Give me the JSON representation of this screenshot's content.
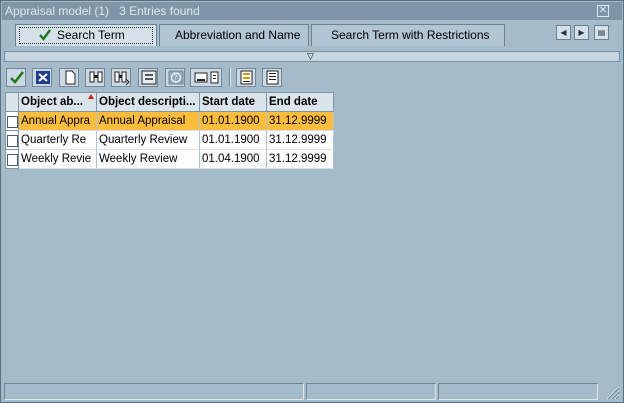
{
  "window": {
    "title": "Appraisal model (1)",
    "entries": "3 Entries found",
    "close_glyph": "✕"
  },
  "tabs": [
    {
      "label": "Search Term",
      "active": true
    },
    {
      "label": "Abbreviation and Name",
      "active": false
    },
    {
      "label": "Search Term with Restrictions",
      "active": false
    }
  ],
  "tab_nav": {
    "prev_glyph": "◀",
    "next_glyph": "▶",
    "menu_glyph": "▤"
  },
  "splitter": {
    "glyph": "▽"
  },
  "toolbar": {
    "icons": [
      "checkmark-icon",
      "cancel-icon",
      "new-document-icon",
      "find-icon",
      "find-next-icon",
      "sort-icon",
      "help-icon",
      "print-icon",
      "select-layout-icon",
      "save-layout-icon"
    ]
  },
  "table": {
    "columns": [
      "Object ab...",
      "Object descripti...",
      "Start date",
      "End date"
    ],
    "rows": [
      [
        "Annual Appra",
        "Annual Appraisal",
        "01.01.1900",
        "31.12.9999"
      ],
      [
        "Quarterly Re",
        "Quarterly Review",
        "01.01.1900",
        "31.12.9999"
      ],
      [
        "Weekly Revie",
        "Weekly Review",
        "01.04.1900",
        "31.12.9999"
      ]
    ],
    "highlighted_row": 0
  },
  "colors": {
    "background": "#a5bbca",
    "highlight": "#fcbc3c",
    "title_bar": "#7e96a8"
  }
}
